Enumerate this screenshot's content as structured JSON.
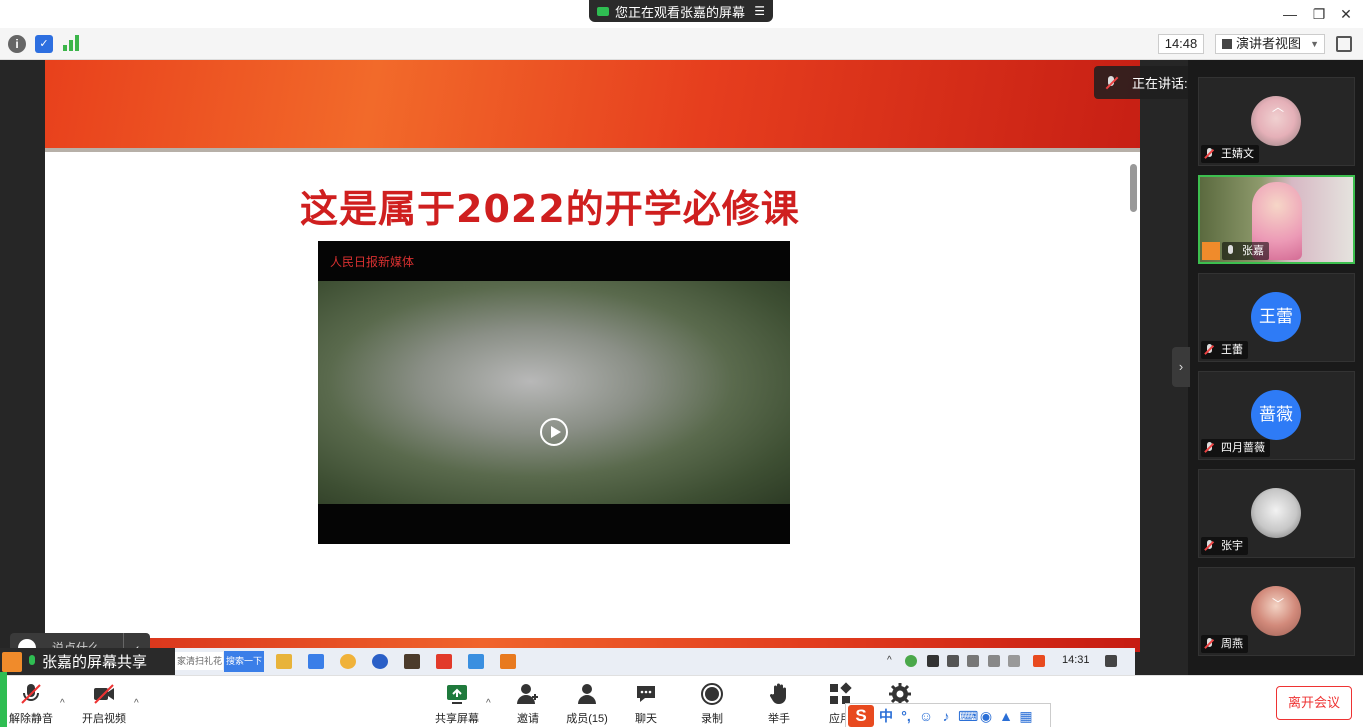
{
  "title_pill": {
    "text": "您正在观看张嘉的屏幕",
    "menu_icon": "menu-icon"
  },
  "window": {
    "minimize": "—",
    "restore": "❐",
    "close": "✕"
  },
  "infobar": {
    "info_icon": "i",
    "shield_icon": "✓",
    "time": "14:48",
    "view_mode": "演讲者视图",
    "view_caret": "▼"
  },
  "speaker": {
    "label": "正在讲话: 张嘉;"
  },
  "slide": {
    "title": "这是属于2022的开学必修课",
    "video_logo": "人民日报新媒体"
  },
  "chat": {
    "placeholder": "说点什么...",
    "arrow": "‹"
  },
  "taskbar": {
    "share_label": "张嘉的屏幕共享",
    "search_text": "家清扫礼花",
    "search_button": "搜索一下",
    "clock": "14:31"
  },
  "participants": [
    {
      "name": "王婧文",
      "avatar_text": "",
      "muted": true
    },
    {
      "name": "张嘉",
      "avatar_text": "",
      "muted": false
    },
    {
      "name": "王蕾",
      "avatar_text": "王蕾",
      "muted": true
    },
    {
      "name": "四月蔷薇",
      "avatar_text": "蔷薇",
      "muted": true
    },
    {
      "name": "张宇",
      "avatar_text": "",
      "muted": true
    },
    {
      "name": "周燕",
      "avatar_text": "",
      "muted": true
    }
  ],
  "panel": {
    "collapse_arrow": "›",
    "scroll_up": "︿",
    "scroll_down": "﹀"
  },
  "controls": {
    "unmute": "解除静音",
    "start_video": "开启视频",
    "share_screen": "共享屏幕",
    "invite": "邀请",
    "members": "成员(15)",
    "chat": "聊天",
    "record": "录制",
    "raise_hand": "举手",
    "apps": "应用",
    "leave": "离开会议",
    "caret": "^"
  },
  "ime": {
    "logo": "S",
    "lang": "中",
    "punct": "°,"
  },
  "colors": {
    "accent_green": "#2fbd52",
    "leave_red": "#ee3333",
    "title_red": "#cf1f1f",
    "avatar_blue": "#2e7bf6"
  }
}
